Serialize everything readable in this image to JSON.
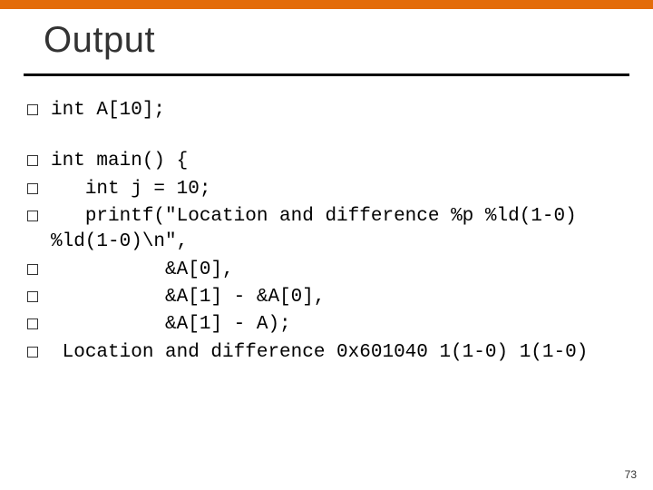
{
  "title": "Output",
  "bullets": [
    "int A[10];",
    "int main() {",
    "   int j = 10;",
    "   printf(\"Location and difference %p %ld(1-0)  %ld(1-0)\\n\",",
    "          &A[0],",
    "          &A[1] - &A[0],",
    "          &A[1] - A);",
    " Location and difference 0x601040 1(1-0) 1(1-0)"
  ],
  "page_number": "73"
}
